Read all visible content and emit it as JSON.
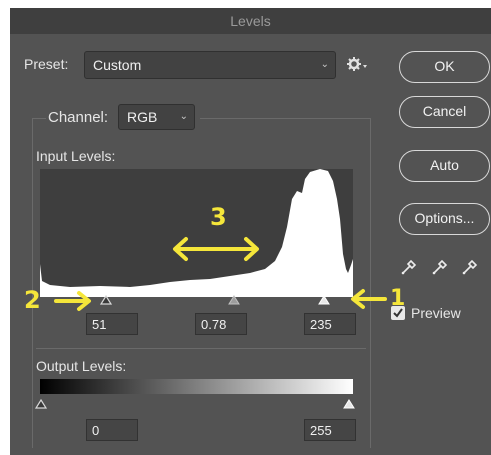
{
  "dialog": {
    "title": "Levels"
  },
  "preset": {
    "label": "Preset:",
    "value": "Custom"
  },
  "channel": {
    "label": "Channel:",
    "value": "RGB"
  },
  "input_levels": {
    "label": "Input Levels:",
    "shadow": "51",
    "midtone": "0.78",
    "highlight": "235"
  },
  "output_levels": {
    "label": "Output Levels:",
    "black": "0",
    "white": "255"
  },
  "buttons": {
    "ok": "OK",
    "cancel": "Cancel",
    "auto": "Auto",
    "options": "Options..."
  },
  "preview": {
    "label": "Preview",
    "checked": true
  },
  "annotations": {
    "one": "1",
    "two": "2",
    "three": "3"
  },
  "icons": {
    "gear": "gear-icon",
    "eyedroppers": [
      "black-eyedropper-icon",
      "gray-eyedropper-icon",
      "white-eyedropper-icon"
    ]
  },
  "colors": {
    "dialog_bg": "#535353",
    "histogram": "#ffffff",
    "annotation": "#f5e63a"
  }
}
